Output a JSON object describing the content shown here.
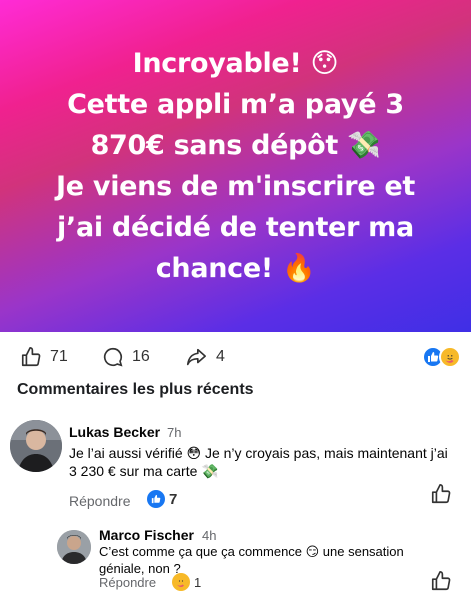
{
  "post": {
    "lines": [
      "Incroyable! 😯",
      "Cette appli m’a payé 3",
      "870€ sans dépôt 💸",
      "Je viens de m'inscrire et",
      "j’ai décidé de tenter ma",
      "chance! 🔥"
    ],
    "gradient_colors": [
      "#ff2bd6",
      "#d1337c",
      "#5b2ee6",
      "#3f2fe6"
    ]
  },
  "actions": {
    "likes": "71",
    "comments": "16",
    "shares": "4"
  },
  "comments_section": {
    "title": "Commentaires les plus récents"
  },
  "comments": [
    {
      "author": "Lukas Becker",
      "time": "7h",
      "text": "Je l’ai aussi vérifié 😳 Je n’y croyais pas, mais maintenant j’ai 3 230 € sur ma carte 💸",
      "reply_label": "Répondre",
      "reaction_count": "7"
    },
    {
      "author": "Marco Fischer",
      "time": "4h",
      "text": "C’est comme ça que ça commence 😏 une sensation géniale, non ?",
      "reply_label": "Répondre",
      "reaction_count": "1"
    }
  ],
  "colors": {
    "like_blue": "#1877f2",
    "care_yellow": "#f7b928",
    "meta_gray": "#65676b"
  }
}
